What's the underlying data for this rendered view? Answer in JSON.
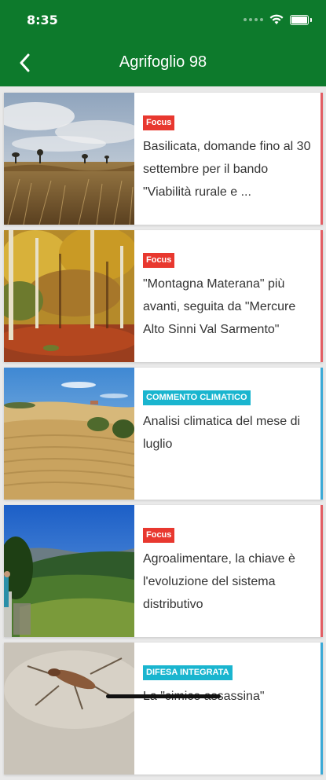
{
  "status_bar": {
    "time": "8:35"
  },
  "header": {
    "title": "Agrifoglio 98",
    "back_icon": "chevron-left-icon"
  },
  "articles": [
    {
      "tag": "Focus",
      "tag_color": "#e8382f",
      "title": "Basilicata, domande fino al 30 settembre per il bando \"Viabilità rurale e ...",
      "accent": "#e25d63"
    },
    {
      "tag": "Focus",
      "tag_color": "#e8382f",
      "title": "\"Montagna Materana\" più avanti, seguita da \"Mercure Alto Sinni Val Sarmento\"",
      "accent": "#e25d63"
    },
    {
      "tag": "COMMENTO CLIMATICO",
      "tag_color": "#1ab5cf",
      "title": "Analisi climatica del mese di luglio",
      "accent": "#3aa9d6"
    },
    {
      "tag": "Focus",
      "tag_color": "#e8382f",
      "title": "Agroalimentare, la chiave è l'evoluzione del sistema distributivo",
      "accent": "#e25d63"
    },
    {
      "tag": "DIFESA INTEGRATA",
      "tag_color": "#1ab5cf",
      "title": "La \"cimice assassina\"",
      "accent": "#3aa9d6"
    }
  ],
  "colors": {
    "header_bg": "#0d7a2c",
    "background": "#e9e9e9"
  }
}
